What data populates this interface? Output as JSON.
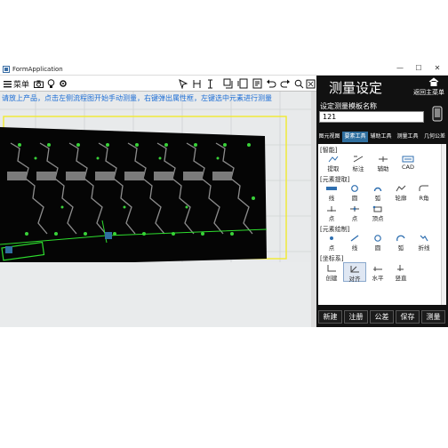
{
  "window": {
    "title": "FormApplication",
    "minimize": "—",
    "maximize": "☐",
    "close": "✕"
  },
  "toolbar": {
    "menu_label": "菜单",
    "hint": "请放上产品，点击左侧流程图开始手动测量，右键弹出属性框，左键选中元素进行测量"
  },
  "panel": {
    "title": "测量设定",
    "home_label": "返回主菜单",
    "template_label": "设定测量模板名称",
    "template_value": "121",
    "tabs": [
      "图元视图",
      "要素工具",
      "辅助工具",
      "测量工具",
      "几何公差"
    ],
    "active_tab": 1,
    "sections": {
      "smart": "[智能]",
      "extract": "[元素提取]",
      "draw": "[元素绘制]",
      "coord": "[坐标系]"
    },
    "smart_tools": [
      "提取",
      "标注",
      "辅助",
      "CAD"
    ],
    "extract_tools_row1": [
      "线",
      "圆",
      "弧",
      "轮廓",
      "R角"
    ],
    "extract_tools_row2": [
      "点",
      "点",
      "顶点"
    ],
    "draw_tools": [
      "点",
      "线",
      "圆",
      "弧",
      "折线"
    ],
    "coord_tools": [
      "创建",
      "对齐",
      "水平",
      "竖直"
    ],
    "buttons": [
      "新建",
      "注册",
      "公差",
      "保存",
      "测量"
    ]
  },
  "colors": {
    "accent_tab": "#2f6f9f",
    "hint": "#1e6fd6",
    "panel_bg": "#111111"
  }
}
